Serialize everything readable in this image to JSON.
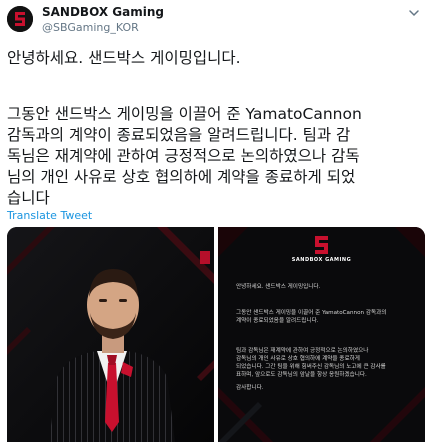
{
  "tweet": {
    "display_name": "SANDBOX Gaming",
    "handle": "@SBGaming_KOR",
    "greeting": "안녕하세요. 샌드박스 게이밍입니다.",
    "body_lines": "그동안 샌드박스 게이밍을 이끌어 준 YamatoCannon\n감독과의 계약이 종료되었음을 알려드립니다. 팀과 감\n독님은 재계약에 관하여 긍정적으로 논의하였으나 감독\n님의 개인 사유로 상호 협의하에 계약을 종료하게 되었\n습니다",
    "translate_label": "Translate Tweet",
    "colors": {
      "brand_red": "#c8102e",
      "link_blue": "#1b95e0",
      "handle_gray": "#657786"
    }
  },
  "media": {
    "right_image": {
      "logo_name": "SANDBOX GAMING",
      "greeting": "안녕하세요. 샌드박스 게이밍입니다.",
      "paragraph1": "그동안 샌드박스 게이밍을 이끌어 준 YamatoCannon 감독과의\n계약이 종료되었음을 알려드립니다.",
      "paragraph2": "팀과 감독님은 재계약에 관하여 긍정적으로 논의하였으나\n감독님의 개인 사유로 상호 협의하에 계약을 종료하게\n되었습니다. 그간 팀을 위해 힘써주신 감독님의 노고에 큰 감사를\n표하며, 앞으로도 감독님의 앞날을 항상 응원하겠습니다.",
      "thanks": "감사합니다."
    }
  }
}
